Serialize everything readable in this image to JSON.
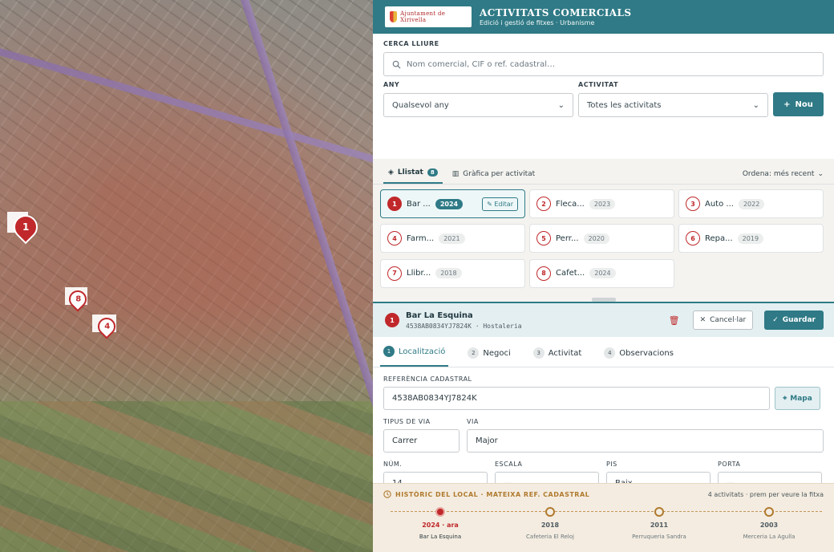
{
  "header": {
    "logo_text": "Ajuntament de Xirivella",
    "title": "ACTIVITATS COMERCIALS",
    "subtitle": "Edició i gestió de fitxes · Urbanisme"
  },
  "search": {
    "free_label": "CERCA LLIURE",
    "free_placeholder": "Nom comercial, CIF o ref. cadastral…",
    "year_label": "ANY",
    "year_value": "Qualsevol any",
    "activity_label": "ACTIVITAT",
    "activity_value": "Totes les activitats",
    "new_button": "Nou"
  },
  "tabs": {
    "list_label": "Llistat",
    "list_count": "8",
    "chart_label": "Gràfica per activitat",
    "sort_label": "Ordena: més recent"
  },
  "map_pins": [
    {
      "num": "1"
    },
    {
      "num": "8"
    },
    {
      "num": "4"
    }
  ],
  "cards": [
    {
      "num": "1",
      "name": "Bar ...",
      "year": "2024",
      "edit": "Editar"
    },
    {
      "num": "2",
      "name": "Fleca...",
      "year": "2023"
    },
    {
      "num": "3",
      "name": "Auto ...",
      "year": "2022"
    },
    {
      "num": "4",
      "name": "Farm...",
      "year": "2021"
    },
    {
      "num": "5",
      "name": "Perr...",
      "year": "2020"
    },
    {
      "num": "6",
      "name": "Repa...",
      "year": "2019"
    },
    {
      "num": "7",
      "name": "Llibr...",
      "year": "2018"
    },
    {
      "num": "8",
      "name": "Cafet...",
      "year": "2024"
    }
  ],
  "detail": {
    "num": "1",
    "name": "Bar La Esquina",
    "ref": "4538AB0834YJ7824K",
    "category": "Hostaleria",
    "cancel": "Cancel·lar",
    "save": "Guardar"
  },
  "steps": [
    {
      "n": "1",
      "label": "Localització"
    },
    {
      "n": "2",
      "label": "Negoci"
    },
    {
      "n": "3",
      "label": "Activitat"
    },
    {
      "n": "4",
      "label": "Observacions"
    }
  ],
  "form": {
    "ref_label": "REFERÈNCIA CADASTRAL",
    "ref_value": "4538AB0834YJ7824K",
    "map_button": "Mapa",
    "via_type_label": "TIPUS DE VIA",
    "via_type_value": "Carrer",
    "via_label": "VIA",
    "via_value": "Major",
    "num_label": "NÚM.",
    "num_value": "14",
    "stair_label": "ESCALA",
    "stair_value": "—",
    "floor_label": "PIS",
    "floor_value": "Baix",
    "door_label": "PORTA",
    "door_value": "—"
  },
  "history": {
    "title": "HISTÒRIC DEL LOCAL · MATEIXA REF. CADASTRAL",
    "note": "4 activitats · prem per veure la fitxa",
    "items": [
      {
        "year": "2024 · ara",
        "name": "Bar La Esquina"
      },
      {
        "year": "2018",
        "name": "Cafeteria El Reloj"
      },
      {
        "year": "2011",
        "name": "Perruqueria Sandra"
      },
      {
        "year": "2003",
        "name": "Merceria La Agulla"
      }
    ]
  },
  "colors": {
    "accent": "#2f7a86",
    "pin": "#c0282b",
    "history_bg": "#f4ece0"
  }
}
